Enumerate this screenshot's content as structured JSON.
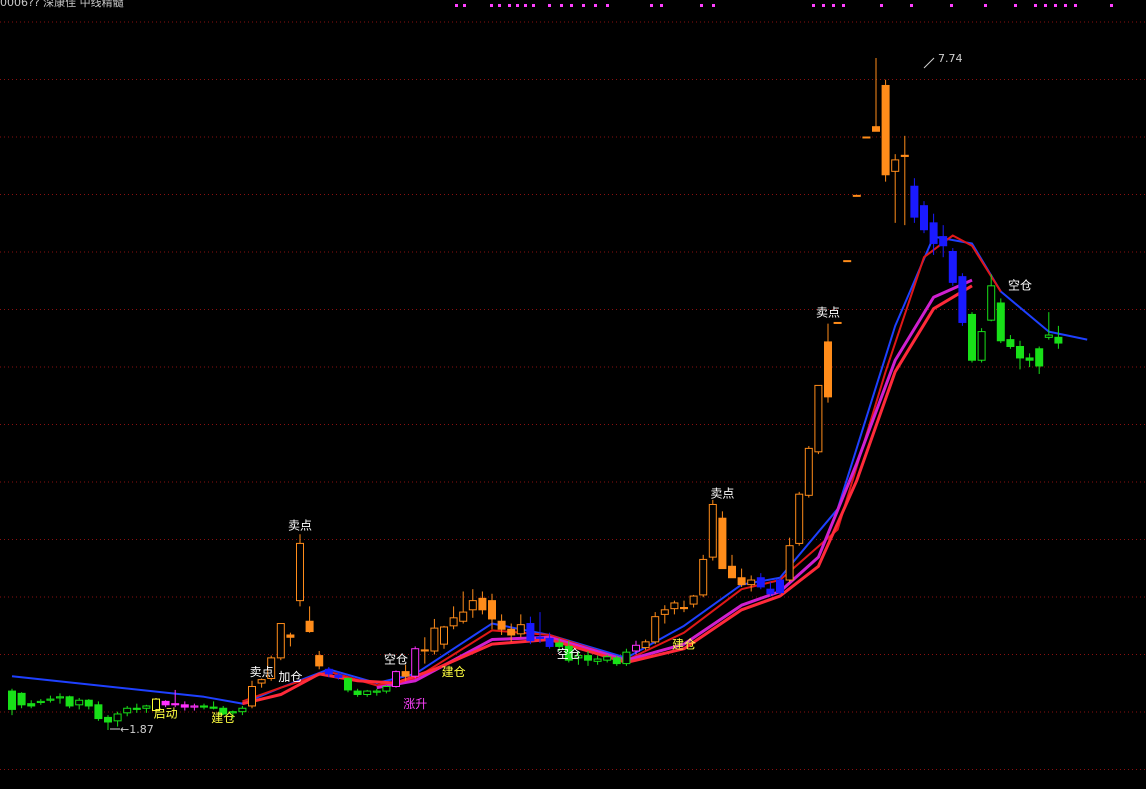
{
  "header": {
    "stock_name": "0006?? 深康佳",
    "indicator": "中线精髓",
    "values_text": ""
  },
  "chart_data": {
    "type": "candlestick",
    "price_range": [
      1.0,
      8.3
    ],
    "grid": "horizontal dotted",
    "extremes": {
      "high": "7.74",
      "low": "1.87"
    },
    "candles": [
      {
        "o": 2.21,
        "h": 2.23,
        "l": 2.0,
        "c": 2.05,
        "col": "green"
      },
      {
        "o": 2.19,
        "h": 2.2,
        "l": 2.06,
        "c": 2.09,
        "col": "green"
      },
      {
        "o": 2.1,
        "h": 2.13,
        "l": 2.06,
        "c": 2.08,
        "col": "green"
      },
      {
        "o": 2.11,
        "h": 2.14,
        "l": 2.09,
        "c": 2.12,
        "col": "green"
      },
      {
        "o": 2.13,
        "h": 2.17,
        "l": 2.11,
        "c": 2.14,
        "col": "green"
      },
      {
        "o": 2.15,
        "h": 2.19,
        "l": 2.1,
        "c": 2.16,
        "col": "green"
      },
      {
        "o": 2.16,
        "h": 2.17,
        "l": 2.06,
        "c": 2.08,
        "col": "green"
      },
      {
        "o": 2.09,
        "h": 2.15,
        "l": 2.05,
        "c": 2.13,
        "col": "green"
      },
      {
        "o": 2.13,
        "h": 2.14,
        "l": 2.05,
        "c": 2.08,
        "col": "green"
      },
      {
        "o": 2.09,
        "h": 2.12,
        "l": 1.95,
        "c": 1.97,
        "col": "green"
      },
      {
        "o": 1.98,
        "h": 2.0,
        "l": 1.87,
        "c": 1.94,
        "col": "green"
      },
      {
        "o": 1.95,
        "h": 2.03,
        "l": 1.9,
        "c": 2.01,
        "col": "green"
      },
      {
        "o": 2.02,
        "h": 2.08,
        "l": 1.99,
        "c": 2.06,
        "col": "green"
      },
      {
        "o": 2.06,
        "h": 2.1,
        "l": 2.02,
        "c": 2.05,
        "col": "green"
      },
      {
        "o": 2.06,
        "h": 2.09,
        "l": 2.02,
        "c": 2.08,
        "col": "green"
      },
      {
        "o": 2.04,
        "h": 2.15,
        "l": 2.03,
        "c": 2.14,
        "col": "yellow"
      },
      {
        "o": 2.12,
        "h": 2.13,
        "l": 2.07,
        "c": 2.09,
        "col": "magenta"
      },
      {
        "o": 2.1,
        "h": 2.22,
        "l": 2.07,
        "c": 2.09,
        "col": "magenta"
      },
      {
        "o": 2.09,
        "h": 2.12,
        "l": 2.04,
        "c": 2.07,
        "col": "magenta"
      },
      {
        "o": 2.07,
        "h": 2.1,
        "l": 2.04,
        "c": 2.08,
        "col": "magenta"
      },
      {
        "o": 2.08,
        "h": 2.1,
        "l": 2.05,
        "c": 2.07,
        "col": "green"
      },
      {
        "o": 2.07,
        "h": 2.12,
        "l": 2.05,
        "c": 2.06,
        "col": "green"
      },
      {
        "o": 2.06,
        "h": 2.08,
        "l": 2.0,
        "c": 2.01,
        "col": "green"
      },
      {
        "o": 2.02,
        "h": 2.04,
        "l": 1.97,
        "c": 2.03,
        "col": "green"
      },
      {
        "o": 2.03,
        "h": 2.08,
        "l": 2.0,
        "c": 2.06,
        "col": "green"
      },
      {
        "o": 2.08,
        "h": 2.3,
        "l": 2.06,
        "c": 2.25,
        "col": "orange"
      },
      {
        "o": 2.28,
        "h": 2.32,
        "l": 2.24,
        "c": 2.31,
        "col": "orange"
      },
      {
        "o": 2.32,
        "h": 2.52,
        "l": 2.3,
        "c": 2.5,
        "col": "orange"
      },
      {
        "o": 2.5,
        "h": 2.8,
        "l": 2.48,
        "c": 2.8,
        "col": "orange"
      },
      {
        "o": 2.7,
        "h": 2.72,
        "l": 2.6,
        "c": 2.68,
        "col": "orange"
      },
      {
        "o": 3.0,
        "h": 3.58,
        "l": 2.95,
        "c": 3.5,
        "col": "orange"
      },
      {
        "o": 2.82,
        "h": 2.95,
        "l": 2.72,
        "c": 2.73,
        "col": "orange"
      },
      {
        "o": 2.52,
        "h": 2.56,
        "l": 2.4,
        "c": 2.43,
        "col": "orange"
      },
      {
        "o": 2.4,
        "h": 2.42,
        "l": 2.33,
        "c": 2.36,
        "col": "blue"
      },
      {
        "o": 2.35,
        "h": 2.37,
        "l": 2.31,
        "c": 2.33,
        "col": "blue"
      },
      {
        "o": 2.32,
        "h": 2.33,
        "l": 2.2,
        "c": 2.22,
        "col": "green"
      },
      {
        "o": 2.21,
        "h": 2.23,
        "l": 2.16,
        "c": 2.18,
        "col": "green"
      },
      {
        "o": 2.18,
        "h": 2.22,
        "l": 2.16,
        "c": 2.21,
        "col": "green"
      },
      {
        "o": 2.2,
        "h": 2.23,
        "l": 2.17,
        "c": 2.21,
        "col": "green"
      },
      {
        "o": 2.21,
        "h": 2.26,
        "l": 2.19,
        "c": 2.25,
        "col": "green"
      },
      {
        "o": 2.25,
        "h": 2.39,
        "l": 2.24,
        "c": 2.38,
        "col": "magenta"
      },
      {
        "o": 2.38,
        "h": 2.44,
        "l": 2.3,
        "c": 2.34,
        "col": "orange"
      },
      {
        "o": 2.34,
        "h": 2.6,
        "l": 2.32,
        "c": 2.58,
        "col": "magenta"
      },
      {
        "o": 2.57,
        "h": 2.68,
        "l": 2.45,
        "c": 2.56,
        "col": "orange"
      },
      {
        "o": 2.56,
        "h": 2.84,
        "l": 2.53,
        "c": 2.76,
        "col": "orange"
      },
      {
        "o": 2.62,
        "h": 2.78,
        "l": 2.58,
        "c": 2.77,
        "col": "orange"
      },
      {
        "o": 2.78,
        "h": 2.95,
        "l": 2.75,
        "c": 2.85,
        "col": "orange"
      },
      {
        "o": 2.82,
        "h": 3.08,
        "l": 2.8,
        "c": 2.9,
        "col": "orange"
      },
      {
        "o": 2.92,
        "h": 3.1,
        "l": 2.85,
        "c": 3.0,
        "col": "orange"
      },
      {
        "o": 3.02,
        "h": 3.08,
        "l": 2.88,
        "c": 2.92,
        "col": "orange"
      },
      {
        "o": 3.0,
        "h": 3.06,
        "l": 2.75,
        "c": 2.84,
        "col": "orange"
      },
      {
        "o": 2.82,
        "h": 2.88,
        "l": 2.7,
        "c": 2.75,
        "col": "orange"
      },
      {
        "o": 2.75,
        "h": 2.8,
        "l": 2.64,
        "c": 2.7,
        "col": "orange"
      },
      {
        "o": 2.71,
        "h": 2.88,
        "l": 2.68,
        "c": 2.79,
        "col": "orange"
      },
      {
        "o": 2.8,
        "h": 2.86,
        "l": 2.62,
        "c": 2.65,
        "col": "blue"
      },
      {
        "o": 2.68,
        "h": 2.9,
        "l": 2.63,
        "c": 2.67,
        "col": "blue"
      },
      {
        "o": 2.67,
        "h": 2.72,
        "l": 2.58,
        "c": 2.6,
        "col": "blue"
      },
      {
        "o": 2.63,
        "h": 2.67,
        "l": 2.56,
        "c": 2.6,
        "col": "green"
      },
      {
        "o": 2.6,
        "h": 2.65,
        "l": 2.46,
        "c": 2.48,
        "col": "green"
      },
      {
        "o": 2.5,
        "h": 2.56,
        "l": 2.44,
        "c": 2.52,
        "col": "green"
      },
      {
        "o": 2.52,
        "h": 2.56,
        "l": 2.43,
        "c": 2.48,
        "col": "green"
      },
      {
        "o": 2.47,
        "h": 2.52,
        "l": 2.44,
        "c": 2.49,
        "col": "green"
      },
      {
        "o": 2.48,
        "h": 2.53,
        "l": 2.46,
        "c": 2.51,
        "col": "green"
      },
      {
        "o": 2.5,
        "h": 2.52,
        "l": 2.43,
        "c": 2.45,
        "col": "green"
      },
      {
        "o": 2.45,
        "h": 2.58,
        "l": 2.43,
        "c": 2.55,
        "col": "green"
      },
      {
        "o": 2.56,
        "h": 2.65,
        "l": 2.53,
        "c": 2.61,
        "col": "magenta"
      },
      {
        "o": 2.59,
        "h": 2.66,
        "l": 2.57,
        "c": 2.64,
        "col": "orange"
      },
      {
        "o": 2.64,
        "h": 2.9,
        "l": 2.62,
        "c": 2.86,
        "col": "orange"
      },
      {
        "o": 2.88,
        "h": 2.96,
        "l": 2.8,
        "c": 2.92,
        "col": "orange"
      },
      {
        "o": 2.93,
        "h": 3.0,
        "l": 2.88,
        "c": 2.98,
        "col": "orange"
      },
      {
        "o": 2.94,
        "h": 3.0,
        "l": 2.9,
        "c": 2.93,
        "col": "orange"
      },
      {
        "o": 2.97,
        "h": 3.05,
        "l": 2.94,
        "c": 3.04,
        "col": "orange"
      },
      {
        "o": 3.05,
        "h": 3.4,
        "l": 3.03,
        "c": 3.36,
        "col": "orange"
      },
      {
        "o": 3.38,
        "h": 3.88,
        "l": 3.35,
        "c": 3.84,
        "col": "orange"
      },
      {
        "o": 3.72,
        "h": 3.78,
        "l": 3.28,
        "c": 3.28,
        "col": "orange"
      },
      {
        "o": 3.3,
        "h": 3.4,
        "l": 3.2,
        "c": 3.2,
        "col": "orange"
      },
      {
        "o": 3.2,
        "h": 3.28,
        "l": 3.12,
        "c": 3.14,
        "col": "orange"
      },
      {
        "o": 3.14,
        "h": 3.22,
        "l": 3.08,
        "c": 3.18,
        "col": "orange"
      },
      {
        "o": 3.2,
        "h": 3.24,
        "l": 3.1,
        "c": 3.12,
        "col": "blue"
      },
      {
        "o": 3.1,
        "h": 3.16,
        "l": 3.04,
        "c": 3.06,
        "col": "blue"
      },
      {
        "o": 3.07,
        "h": 3.2,
        "l": 3.05,
        "c": 3.18,
        "col": "blue"
      },
      {
        "o": 3.18,
        "h": 3.55,
        "l": 3.16,
        "c": 3.48,
        "col": "orange"
      },
      {
        "o": 3.5,
        "h": 3.95,
        "l": 3.48,
        "c": 3.93,
        "col": "orange"
      },
      {
        "o": 3.92,
        "h": 4.35,
        "l": 3.9,
        "c": 4.33,
        "col": "orange"
      },
      {
        "o": 4.3,
        "h": 4.88,
        "l": 4.28,
        "c": 4.88,
        "col": "orange"
      },
      {
        "o": 5.26,
        "h": 5.42,
        "l": 4.73,
        "c": 4.78,
        "col": "orange"
      },
      {
        "o": 5.43,
        "h": 5.43,
        "l": 5.42,
        "c": 5.43,
        "col": "orange"
      },
      {
        "o": 5.97,
        "h": 5.97,
        "l": 5.96,
        "c": 5.97,
        "col": "orange"
      },
      {
        "o": 6.54,
        "h": 6.54,
        "l": 6.53,
        "c": 6.54,
        "col": "orange"
      },
      {
        "o": 7.05,
        "h": 7.05,
        "l": 7.04,
        "c": 7.05,
        "col": "orange"
      },
      {
        "o": 7.14,
        "h": 7.74,
        "l": 7.1,
        "c": 7.1,
        "col": "orange"
      },
      {
        "o": 7.5,
        "h": 7.55,
        "l": 6.66,
        "c": 6.72,
        "col": "orange"
      },
      {
        "o": 6.75,
        "h": 6.9,
        "l": 6.3,
        "c": 6.85,
        "col": "orange"
      },
      {
        "o": 6.89,
        "h": 7.06,
        "l": 6.28,
        "c": 6.88,
        "col": "orange"
      },
      {
        "o": 6.62,
        "h": 6.69,
        "l": 6.3,
        "c": 6.35,
        "col": "blue"
      },
      {
        "o": 6.45,
        "h": 6.49,
        "l": 6.21,
        "c": 6.24,
        "col": "blue"
      },
      {
        "o": 6.3,
        "h": 6.38,
        "l": 6.02,
        "c": 6.12,
        "col": "blue"
      },
      {
        "o": 6.1,
        "h": 6.28,
        "l": 6.0,
        "c": 6.18,
        "col": "blue"
      },
      {
        "o": 6.05,
        "h": 6.08,
        "l": 5.75,
        "c": 5.78,
        "col": "blue"
      },
      {
        "o": 5.83,
        "h": 5.86,
        "l": 5.4,
        "c": 5.43,
        "col": "blue"
      },
      {
        "o": 5.5,
        "h": 5.52,
        "l": 5.08,
        "c": 5.1,
        "col": "green"
      },
      {
        "o": 5.1,
        "h": 5.38,
        "l": 5.08,
        "c": 5.35,
        "col": "green"
      },
      {
        "o": 5.45,
        "h": 5.85,
        "l": 5.44,
        "c": 5.75,
        "col": "green"
      },
      {
        "o": 5.6,
        "h": 5.64,
        "l": 5.25,
        "c": 5.27,
        "col": "green"
      },
      {
        "o": 5.28,
        "h": 5.32,
        "l": 5.2,
        "c": 5.22,
        "col": "green"
      },
      {
        "o": 5.22,
        "h": 5.27,
        "l": 5.02,
        "c": 5.12,
        "col": "green"
      },
      {
        "o": 5.12,
        "h": 5.16,
        "l": 5.04,
        "c": 5.1,
        "col": "green"
      },
      {
        "o": 5.2,
        "h": 5.22,
        "l": 4.98,
        "c": 5.05,
        "col": "green"
      },
      {
        "o": 5.3,
        "h": 5.52,
        "l": 5.28,
        "c": 5.32,
        "col": "green"
      },
      {
        "o": 5.3,
        "h": 5.4,
        "l": 5.2,
        "c": 5.25,
        "col": "green"
      }
    ],
    "lines": [
      {
        "name": "blue_upper",
        "color": "#1e40ff",
        "width": 2,
        "pts": [
          [
            0,
            2.34
          ],
          [
            10,
            2.25
          ],
          [
            20,
            2.16
          ],
          [
            24,
            2.1
          ],
          [
            28,
            2.24
          ],
          [
            33,
            2.4
          ],
          [
            38,
            2.28
          ],
          [
            42,
            2.36
          ],
          [
            50,
            2.8
          ],
          [
            56,
            2.7
          ],
          [
            64,
            2.5
          ],
          [
            70,
            2.78
          ],
          [
            76,
            3.14
          ],
          [
            80,
            3.2
          ],
          [
            86,
            3.8
          ],
          [
            92,
            5.4
          ],
          [
            96,
            6.18
          ],
          [
            100,
            6.12
          ],
          [
            103,
            5.7
          ],
          [
            108,
            5.35
          ],
          [
            112,
            5.28
          ]
        ]
      },
      {
        "name": "red_upper",
        "color": "#e01818",
        "width": 2,
        "pts": [
          [
            24,
            2.12
          ],
          [
            28,
            2.24
          ],
          [
            33,
            2.38
          ],
          [
            38,
            2.26
          ],
          [
            42,
            2.32
          ],
          [
            50,
            2.74
          ],
          [
            56,
            2.7
          ],
          [
            64,
            2.48
          ],
          [
            70,
            2.72
          ],
          [
            76,
            3.1
          ],
          [
            80,
            3.18
          ],
          [
            86,
            3.62
          ],
          [
            91,
            5.0
          ],
          [
            95,
            6.0
          ],
          [
            98,
            6.19
          ],
          [
            100,
            6.1
          ],
          [
            103,
            5.7
          ]
        ]
      },
      {
        "name": "magenta_mid",
        "color": "#d020d0",
        "width": 3,
        "pts": [
          [
            38,
            2.24
          ],
          [
            42,
            2.3
          ],
          [
            50,
            2.66
          ],
          [
            56,
            2.68
          ],
          [
            64,
            2.48
          ],
          [
            70,
            2.62
          ],
          [
            76,
            2.96
          ],
          [
            80,
            3.08
          ],
          [
            84,
            3.38
          ],
          [
            88,
            4.2
          ],
          [
            92,
            5.1
          ],
          [
            96,
            5.65
          ],
          [
            100,
            5.8
          ]
        ]
      },
      {
        "name": "red_lower",
        "color": "#ff2a3a",
        "width": 3,
        "pts": [
          [
            24,
            2.1
          ],
          [
            28,
            2.18
          ],
          [
            32,
            2.36
          ],
          [
            36,
            2.3
          ],
          [
            40,
            2.28
          ],
          [
            44,
            2.4
          ],
          [
            50,
            2.62
          ],
          [
            56,
            2.66
          ],
          [
            64,
            2.46
          ],
          [
            70,
            2.58
          ],
          [
            76,
            2.92
          ],
          [
            80,
            3.04
          ],
          [
            84,
            3.3
          ],
          [
            88,
            4.05
          ],
          [
            92,
            5.0
          ],
          [
            96,
            5.55
          ],
          [
            100,
            5.75
          ]
        ]
      }
    ],
    "annotations": [
      {
        "text": "卖点",
        "i": 30,
        "p": 3.62,
        "color": "white"
      },
      {
        "text": "卖点",
        "i": 26,
        "p": 2.34,
        "color": "white"
      },
      {
        "text": "加仓",
        "i": 29,
        "p": 2.3,
        "color": "white"
      },
      {
        "text": "空仓",
        "i": 40,
        "p": 2.45,
        "color": "white"
      },
      {
        "text": "涨升",
        "i": 42,
        "p": 2.06,
        "color": "magenta"
      },
      {
        "text": "建仓",
        "i": 46,
        "p": 2.34,
        "color": "yellow"
      },
      {
        "text": "空仓",
        "i": 58,
        "p": 2.5,
        "color": "white"
      },
      {
        "text": "卖点",
        "i": 74,
        "p": 3.9,
        "color": "white"
      },
      {
        "text": "建仓",
        "i": 70,
        "p": 2.58,
        "color": "yellow"
      },
      {
        "text": "卖点",
        "i": 85,
        "p": 5.48,
        "color": "white"
      },
      {
        "text": "启动",
        "i": 16,
        "p": 1.98,
        "color": "yellow"
      },
      {
        "text": "建仓",
        "i": 22,
        "p": 1.94,
        "color": "yellow"
      },
      {
        "text": "空仓",
        "i": 105,
        "p": 5.72,
        "color": "white"
      }
    ]
  }
}
